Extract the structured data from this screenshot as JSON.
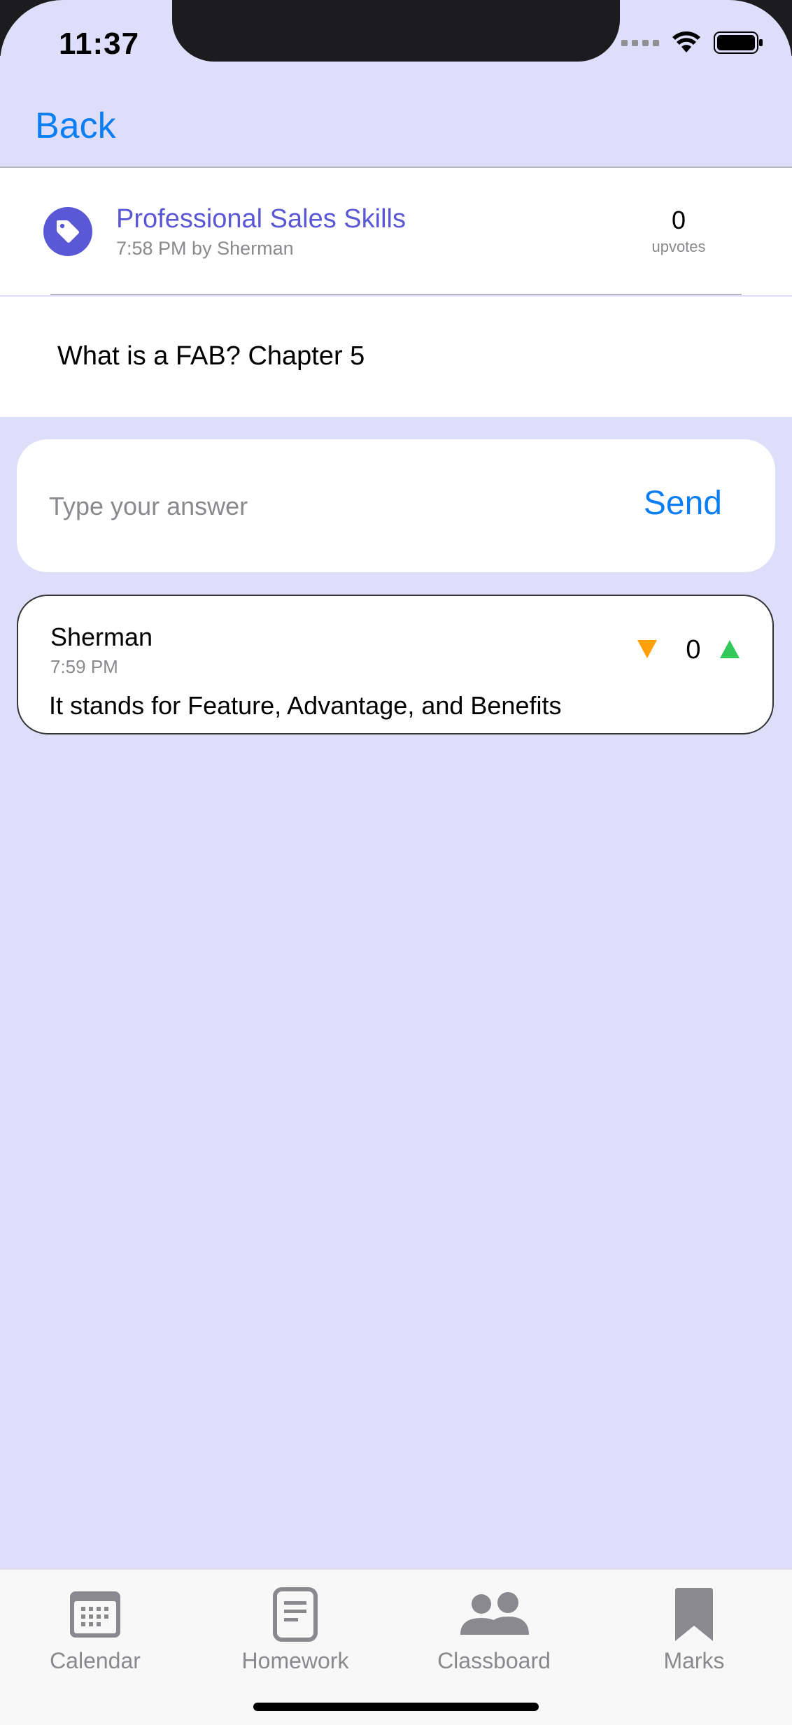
{
  "status_bar": {
    "time": "11:37"
  },
  "nav": {
    "back_label": "Back"
  },
  "post": {
    "title": "Professional Sales Skills",
    "meta": "7:58 PM by Sherman",
    "upvotes_count": "0",
    "upvotes_label": "upvotes",
    "question": "What is a FAB? Chapter 5"
  },
  "answer_input": {
    "placeholder": "Type your answer",
    "send_label": "Send"
  },
  "answers": [
    {
      "author": "Sherman",
      "time": "7:59 PM",
      "votes": "0",
      "body": "It stands for Feature, Advantage, and Benefits"
    }
  ],
  "tab_bar": {
    "tabs": [
      {
        "label": "Calendar",
        "icon": "calendar-icon"
      },
      {
        "label": "Homework",
        "icon": "document-icon"
      },
      {
        "label": "Classboard",
        "icon": "people-icon"
      },
      {
        "label": "Marks",
        "icon": "bookmark-icon"
      }
    ]
  },
  "colors": {
    "background": "#dedefa",
    "accent_blue": "#0a7ef5",
    "accent_purple": "#5b58d6",
    "downvote": "#ff9f0a",
    "upvote": "#34c759"
  }
}
